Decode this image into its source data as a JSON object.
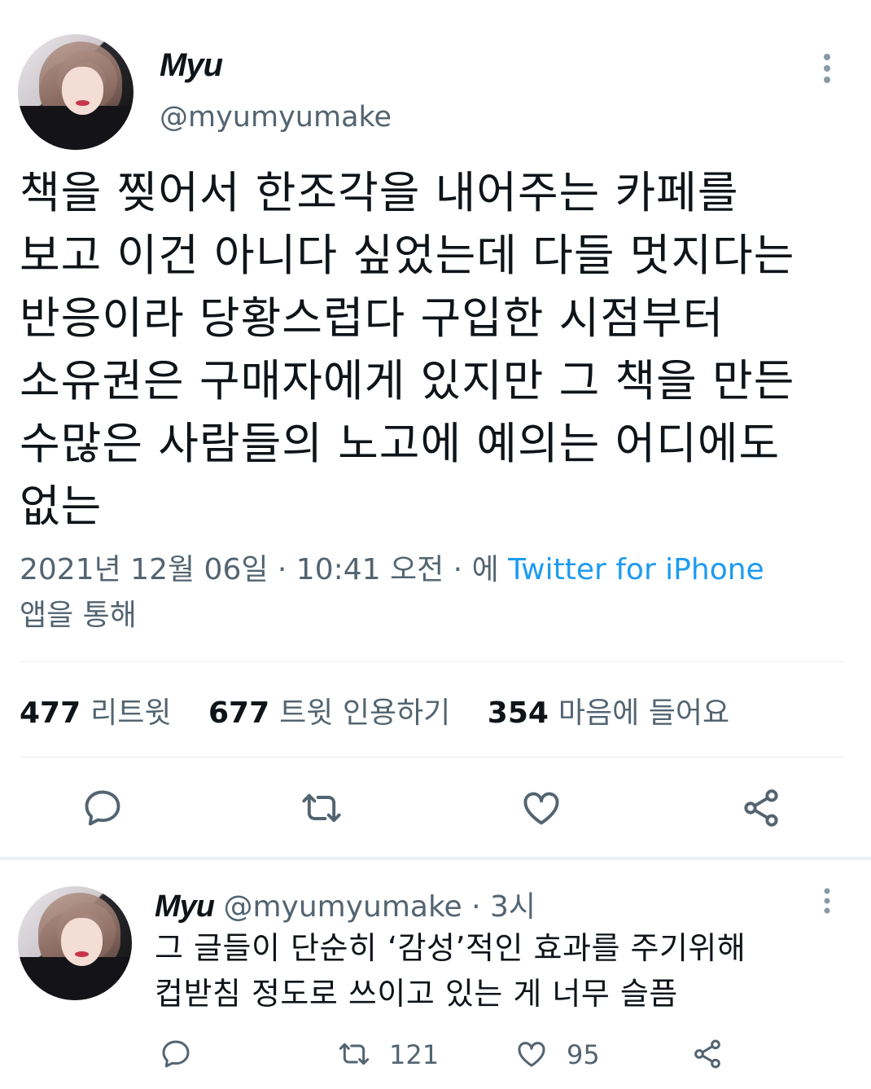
{
  "tweet": {
    "author_name": "Myu",
    "author_handle": "@myumyumake",
    "text_lines": [
      "책을 찢어서 한조각을 내어주는 카페를",
      "보고 이건 아니다 싶었는데 다들 멋지다는",
      "반응이라 당황스럽다 구입한 시점부터",
      "소유권은 구매자에게 있지만 그 책을 만든",
      "수많은 사람들의 노고에 예의는 어디에도",
      "없는"
    ],
    "timestamp": "2021년 12월 06일 · 10:41 오전 · 에 ",
    "source": "Twitter for iPhone",
    "source_suffix": "앱을 통해",
    "stats": {
      "retweets_count": "477",
      "retweets_label": "리트윗",
      "quotes_count": "677",
      "quotes_label": "트윗 인용하기",
      "likes_count": "354",
      "likes_label": "마음에 들어요"
    },
    "actions": [
      "reply-icon",
      "retweet-icon",
      "like-icon",
      "share-icon"
    ]
  },
  "reply": {
    "author_name": "Myu",
    "author_handle": "@myumyumake",
    "time": " · 3시",
    "text_lines": [
      "그 글들이 단순히 ‘감성’적인 효과를 주기위해",
      "컵받침 정도로 쓰이고 있는 게 너무 슬픔"
    ],
    "retweet_count": "121",
    "like_count": "95"
  },
  "colors": {
    "text": "#0f1419",
    "secondary": "#536471",
    "link": "#1d9bf0",
    "divider": "#e6ecf0"
  }
}
